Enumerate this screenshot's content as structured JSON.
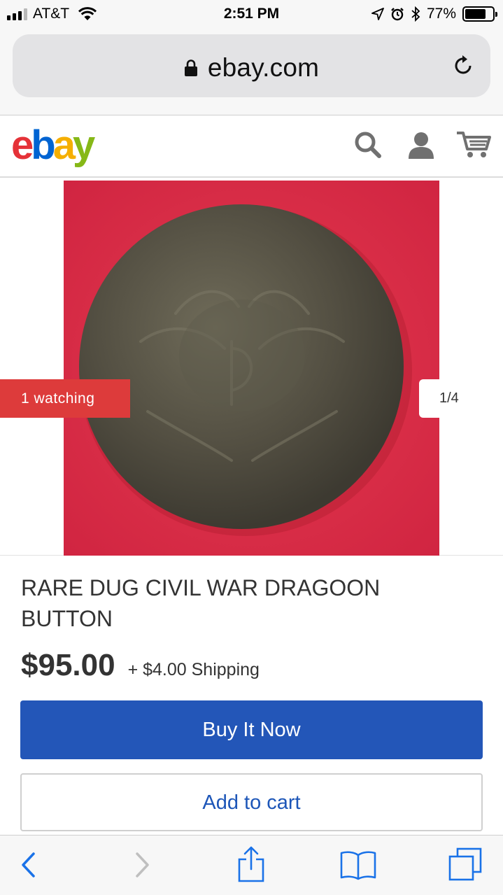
{
  "status_bar": {
    "carrier": "AT&T",
    "time": "2:51 PM",
    "battery_percent": "77%",
    "battery_level": 0.77,
    "icons": [
      "signal-bars-icon",
      "wifi-icon",
      "location-arrow-icon",
      "alarm-icon",
      "bluetooth-icon",
      "battery-icon"
    ]
  },
  "browser": {
    "url": "ebay.com",
    "icons": [
      "lock-icon",
      "reload-icon"
    ]
  },
  "header": {
    "logo": [
      "e",
      "b",
      "a",
      "y"
    ],
    "logo_colors": [
      "#e53238",
      "#0064d2",
      "#f5af02",
      "#86b817"
    ],
    "icons": [
      "search-icon",
      "account-icon",
      "cart-icon"
    ]
  },
  "gallery": {
    "watching_label": "1 watching",
    "image_counter": "1/4",
    "accent_color": "#dd3b3b"
  },
  "item": {
    "title": "RARE DUG CIVIL WAR DRAGOON BUTTON",
    "price": "$95.00",
    "shipping": "+ $4.00 Shipping"
  },
  "actions": {
    "buy_now_label": "Buy It Now",
    "add_to_cart_label": "Add to cart",
    "buy_color": "#2356b8"
  },
  "toolbar": {
    "icons": [
      "back-icon",
      "forward-icon",
      "share-icon",
      "bookmarks-icon",
      "tabs-icon"
    ]
  }
}
